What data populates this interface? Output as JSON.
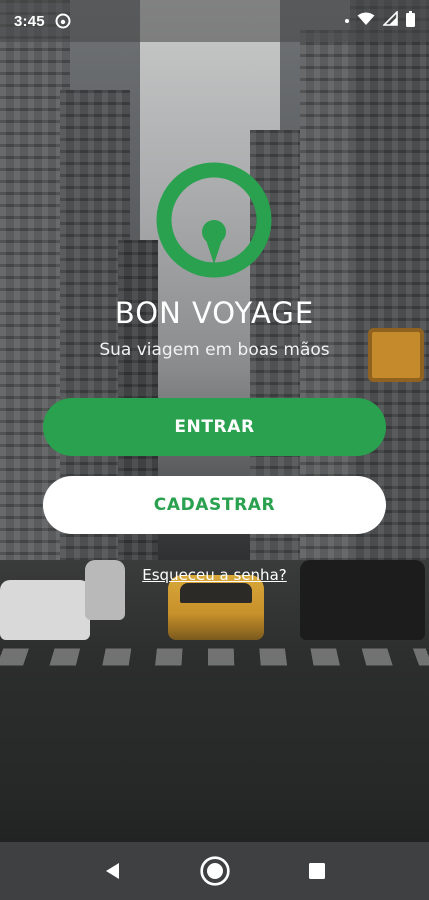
{
  "status_bar": {
    "time": "3:45",
    "app_icon": "circle-logo-icon",
    "icons": [
      "notification-dot-icon",
      "wifi-icon",
      "signal-icon",
      "battery-icon"
    ]
  },
  "brand": {
    "name": "BON VOYAGE",
    "tagline": "Sua viagem em boas mãos",
    "logo_icon": "location-pin-ring-icon",
    "accent_color": "#29a14f"
  },
  "actions": {
    "login_label": "ENTRAR",
    "signup_label": "CADASTRAR",
    "forgot_password_label": "Esqueceu a senha?"
  },
  "nav_bar": {
    "buttons": [
      "back-icon",
      "home-icon",
      "recents-icon"
    ]
  }
}
